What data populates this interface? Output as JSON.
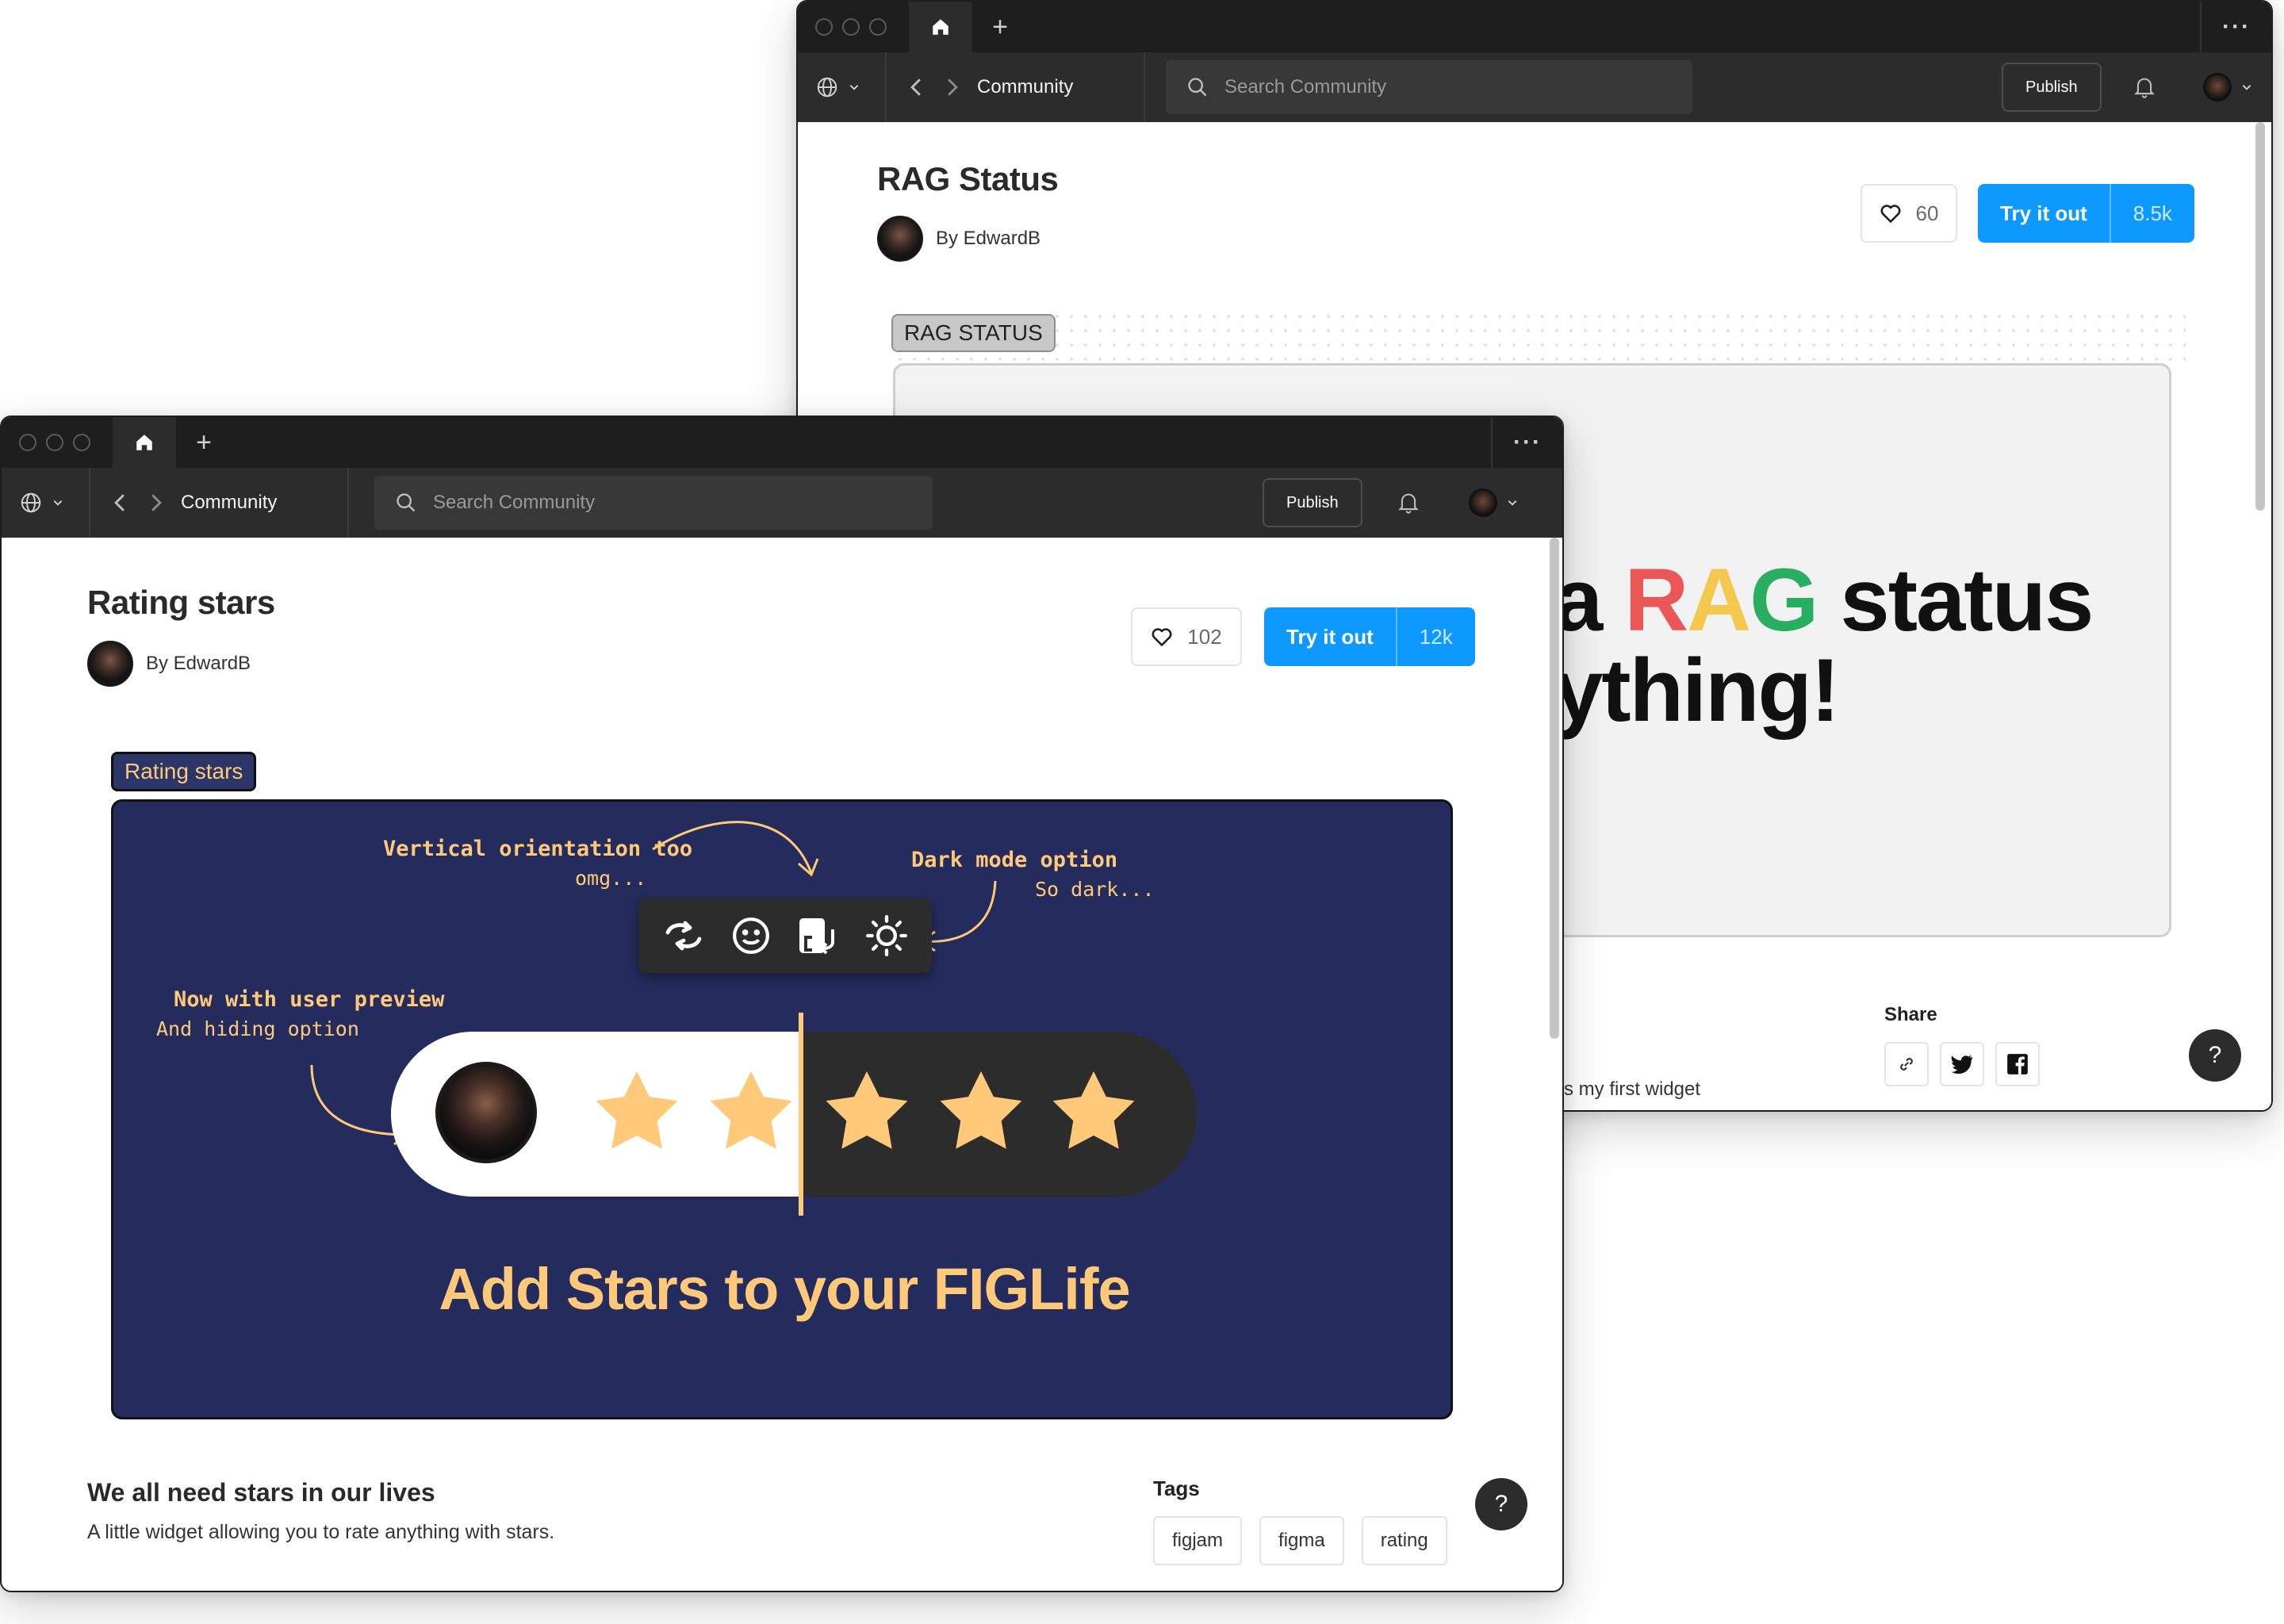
{
  "back_window": {
    "toolbar": {
      "title": "Community",
      "search_placeholder": "Search Community",
      "publish_label": "Publish"
    },
    "page": {
      "title": "RAG Status",
      "author": "By EdwardB",
      "likes": "60",
      "try_label": "Try it out",
      "try_count": "8.5k",
      "badge": "RAG STATUS",
      "hero_line1_a": "a ",
      "hero_r": "R",
      "hero_a": "A",
      "hero_g": "G",
      "hero_line1_b": " status",
      "hero_line2": "ything!",
      "description_fragment": "s my first widget",
      "share_heading": "Share",
      "help_label": "?"
    },
    "colors": {
      "red": "#eb5757",
      "amber": "#f2c94c",
      "green": "#27ae60"
    }
  },
  "front_window": {
    "toolbar": {
      "title": "Community",
      "search_placeholder": "Search Community",
      "publish_label": "Publish"
    },
    "page": {
      "title": "Rating stars",
      "author": "By EdwardB",
      "likes": "102",
      "try_label": "Try it out",
      "try_count": "12k",
      "badge": "Rating stars",
      "description_heading": "We all need stars in our lives",
      "description_text": "A little widget allowing you to rate anything with stars.",
      "tags_heading": "Tags",
      "tags": [
        "figjam",
        "figma",
        "rating"
      ],
      "help_label": "?"
    },
    "hero": {
      "annotation_vertical": "Vertical orientation too",
      "annotation_vertical_sub": "omg...",
      "annotation_dark": "Dark mode option",
      "annotation_dark_sub": "So dark...",
      "annotation_preview": "Now with user preview",
      "annotation_preview_sub": "And hiding option",
      "headline": "Add Stars to your FIGLife",
      "toolbar_icons": [
        "rotate-icon",
        "smiley-icon",
        "swap-layout-icon",
        "sun-icon"
      ],
      "stars_total": 5,
      "background": "#232c5c",
      "accent": "#ffc979"
    }
  }
}
